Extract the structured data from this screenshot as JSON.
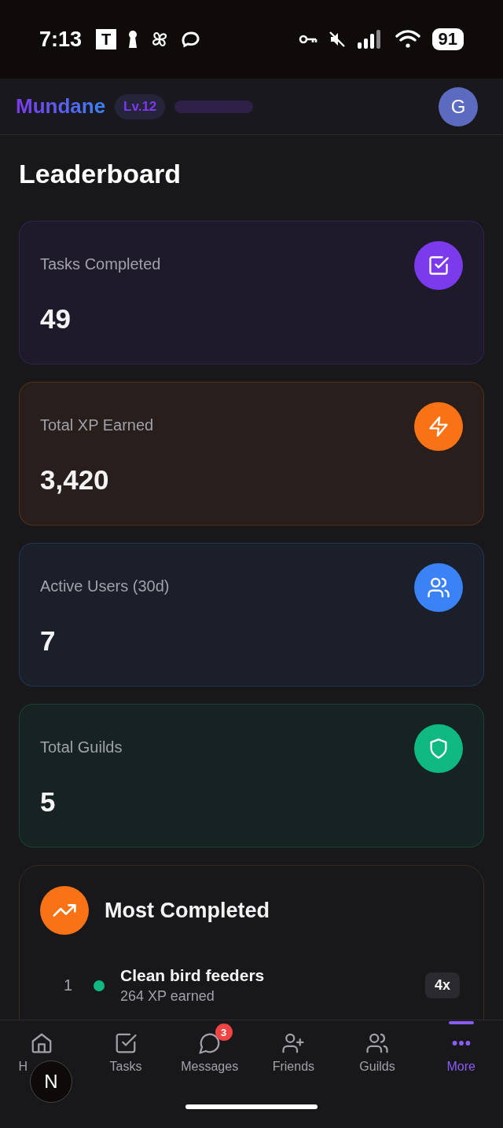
{
  "status_bar": {
    "time": "7:13",
    "app_letter": "T",
    "battery": "91"
  },
  "header": {
    "logo": "Mundane",
    "level_badge": "Lv.12",
    "avatar": "G"
  },
  "page_title": "Leaderboard",
  "stats": [
    {
      "label": "Tasks Completed",
      "value": "49",
      "kind": "tasks",
      "color": "#7c3aed"
    },
    {
      "label": "Total XP Earned",
      "value": "3,420",
      "kind": "xp",
      "color": "#f97316"
    },
    {
      "label": "Active Users (30d)",
      "value": "7",
      "kind": "users",
      "color": "#3b82f6"
    },
    {
      "label": "Total Guilds",
      "value": "5",
      "kind": "guilds",
      "color": "#10b981"
    }
  ],
  "most_completed": {
    "title": "Most Completed",
    "rows": [
      {
        "rank": "1",
        "name": "Clean bird feeders",
        "xp": "264 XP earned",
        "count": "4x",
        "color": "#10b981"
      }
    ]
  },
  "bottom_nav": [
    {
      "label": "H",
      "kind": "home",
      "selected": false
    },
    {
      "label": "Tasks",
      "kind": "tasks",
      "selected": false
    },
    {
      "label": "Messages",
      "kind": "messages",
      "selected": false,
      "badge": "3"
    },
    {
      "label": "Friends",
      "kind": "friends",
      "selected": false
    },
    {
      "label": "Guilds",
      "kind": "guilds",
      "selected": false
    },
    {
      "label": "More",
      "kind": "more",
      "selected": true
    }
  ],
  "dev_badge": "N"
}
